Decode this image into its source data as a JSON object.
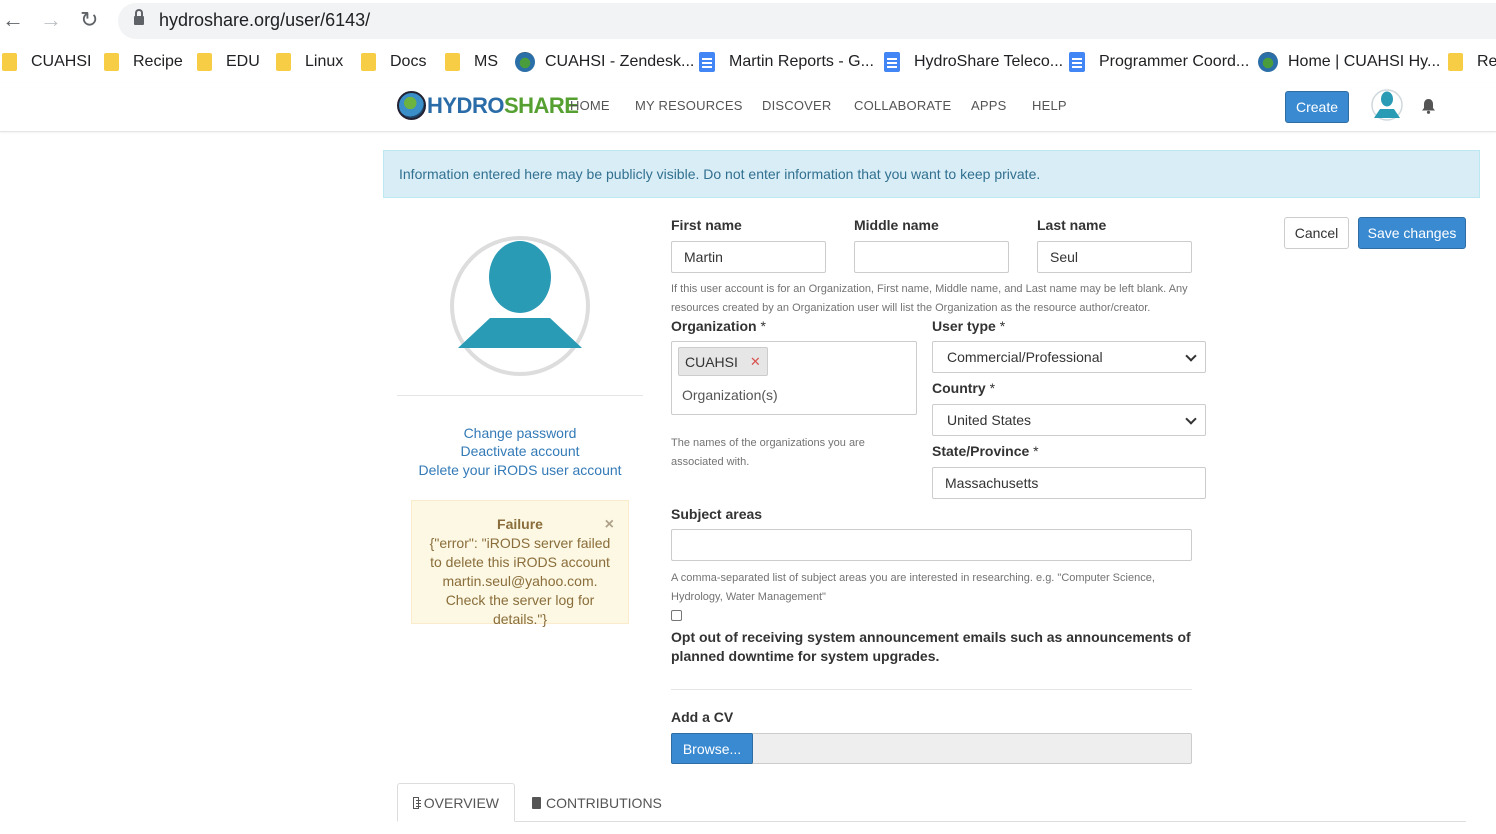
{
  "browser": {
    "url": "hydroshare.org/user/6143/",
    "bookmarks": [
      {
        "label": "CUAHSI",
        "icon": "folder-icon"
      },
      {
        "label": "Recipe",
        "icon": "folder-icon"
      },
      {
        "label": "EDU",
        "icon": "folder-icon"
      },
      {
        "label": "Linux",
        "icon": "folder-icon"
      },
      {
        "label": "Docs",
        "icon": "folder-icon"
      },
      {
        "label": "MS",
        "icon": "folder-icon"
      },
      {
        "label": "CUAHSI - Zendesk...",
        "icon": "globe-icon"
      },
      {
        "label": "Martin Reports - G...",
        "icon": "doc-icon"
      },
      {
        "label": "HydroShare Teleco...",
        "icon": "doc-icon"
      },
      {
        "label": "Programmer Coord...",
        "icon": "doc-icon"
      },
      {
        "label": "Home | CUAHSI Hy...",
        "icon": "globe-icon"
      },
      {
        "label": "Rer",
        "icon": "folder-icon"
      }
    ]
  },
  "header": {
    "logo_a": "HYDRO",
    "logo_b": "SHARE",
    "nav": [
      "HOME",
      "MY RESOURCES",
      "DISCOVER",
      "COLLABORATE",
      "APPS",
      "HELP"
    ],
    "create_label": "Create"
  },
  "info_alert": "Information entered here may be publicly visible. Do not enter information that you want to keep private.",
  "sidebar": {
    "links": [
      "Change password",
      "Deactivate account",
      "Delete your iRODS user account"
    ],
    "failure": {
      "title": "Failure",
      "message": "{\"error\": \"iRODS server failed to delete this iRODS account martin.seul@yahoo.com. Check the server log for details.\"}",
      "close": "×"
    }
  },
  "form": {
    "first_name_label": "First name",
    "first_name_value": "Martin",
    "middle_name_label": "Middle name",
    "middle_name_value": "",
    "last_name_label": "Last name",
    "last_name_value": "Seul",
    "name_help": "If this user account is for an Organization, First name, Middle name, and Last name may be left blank. Any resources created by an Organization user will list the Organization as the resource author/creator.",
    "organization_label": "Organization",
    "organization_tag": "CUAHSI",
    "organization_placeholder": "Organization(s)",
    "organization_help": "The names of the organizations you are associated with.",
    "user_type_label": "User type",
    "user_type_value": "Commercial/Professional",
    "country_label": "Country",
    "country_value": "United States",
    "state_label": "State/Province",
    "state_value": "Massachusetts",
    "subject_label": "Subject areas",
    "subject_value": "",
    "subject_help": "A comma-separated list of subject areas you are interested in researching. e.g. \"Computer Science, Hydrology, Water Management\"",
    "optout_label": "Opt out of receiving system announcement emails such as announcements of planned downtime for system upgrades.",
    "required_mark": "*",
    "cv_label": "Add a CV",
    "browse_label": "Browse..."
  },
  "actions": {
    "cancel": "Cancel",
    "save": "Save changes"
  },
  "tabs": [
    "OVERVIEW",
    "CONTRIBUTIONS"
  ],
  "colors": {
    "primary": "#3a8ad1",
    "avatar": "#2a9bb5",
    "info_bg": "#d9edf7",
    "warning_bg": "#fcf8e3"
  }
}
